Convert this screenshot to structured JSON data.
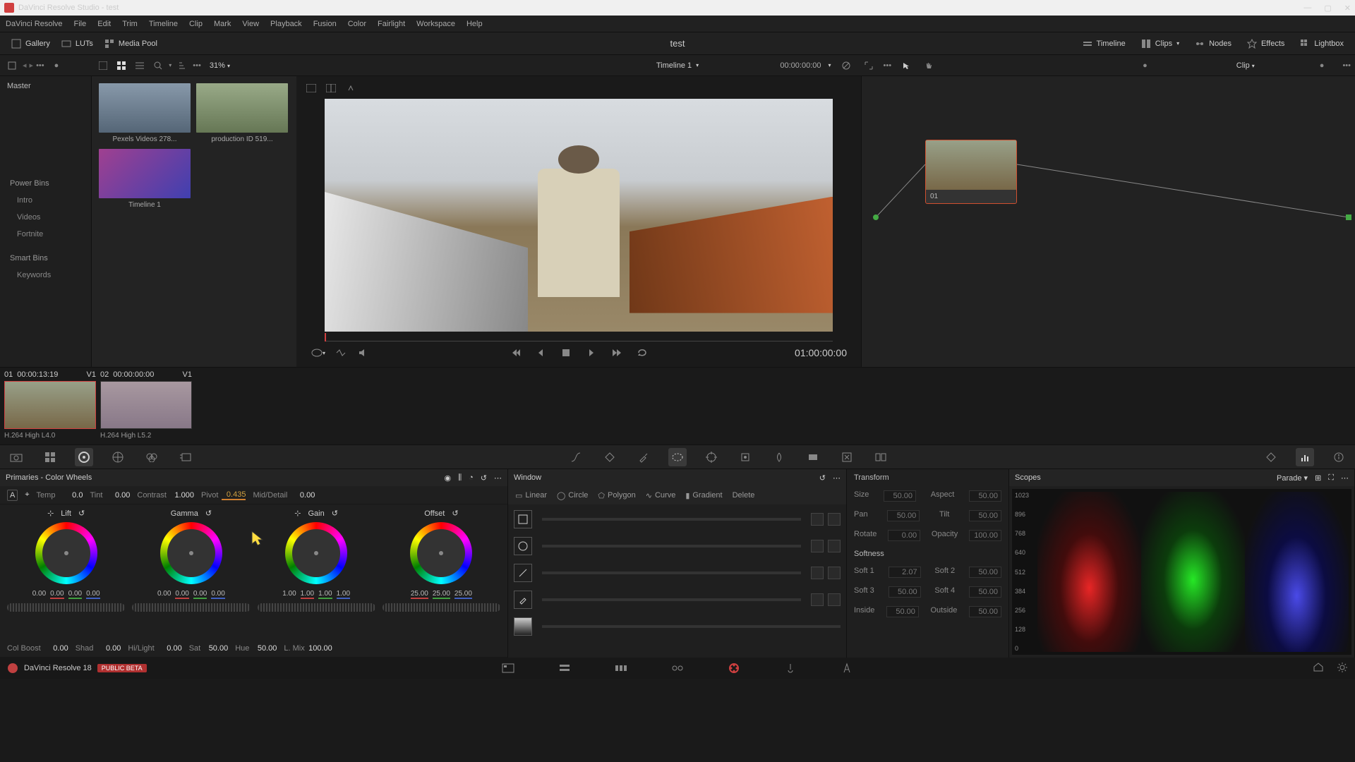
{
  "window": {
    "title": "DaVinci Resolve Studio - test"
  },
  "menu": [
    "DaVinci Resolve",
    "File",
    "Edit",
    "Trim",
    "Timeline",
    "Clip",
    "Mark",
    "View",
    "Playback",
    "Fusion",
    "Color",
    "Fairlight",
    "Workspace",
    "Help"
  ],
  "toolbar": {
    "gallery": "Gallery",
    "luts": "LUTs",
    "mediapool": "Media Pool",
    "project": "test",
    "timeline_btn": "Timeline",
    "clips_btn": "Clips",
    "nodes_btn": "Nodes",
    "effects_btn": "Effects",
    "lightbox_btn": "Lightbox"
  },
  "subbar": {
    "zoom": "31%",
    "timeline_name": "Timeline 1",
    "timecode": "00:00:00:00",
    "clip_label": "Clip"
  },
  "mediapool": {
    "master": "Master",
    "powerbins": "Power Bins",
    "bins": [
      "Intro",
      "Videos",
      "Fortnite"
    ],
    "smartbins": "Smart Bins",
    "smart_items": [
      "Keywords"
    ],
    "thumbs": [
      {
        "label": "Pexels Videos 278..."
      },
      {
        "label": "production ID 519..."
      },
      {
        "label": "Timeline 1",
        "type": "timeline"
      }
    ]
  },
  "viewer": {
    "tc": "01:00:00:00"
  },
  "node": {
    "label": "01"
  },
  "clips": [
    {
      "idx": "01",
      "tc": "00:00:13:19",
      "layer": "V1",
      "codec": "H.264 High L4.0",
      "active": true
    },
    {
      "idx": "02",
      "tc": "00:00:00:00",
      "layer": "V1",
      "codec": "H.264 High L5.2",
      "active": false
    }
  ],
  "primaries": {
    "title": "Primaries - Color Wheels",
    "adjust": {
      "temp_l": "Temp",
      "temp_v": "0.0",
      "tint_l": "Tint",
      "tint_v": "0.00",
      "contrast_l": "Contrast",
      "contrast_v": "1.000",
      "pivot_l": "Pivot",
      "pivot_v": "0.435",
      "md_l": "Mid/Detail",
      "md_v": "0.00"
    },
    "wheels": [
      {
        "name": "Lift",
        "vals": [
          "0.00",
          "0.00",
          "0.00",
          "0.00"
        ]
      },
      {
        "name": "Gamma",
        "vals": [
          "0.00",
          "0.00",
          "0.00",
          "0.00"
        ]
      },
      {
        "name": "Gain",
        "vals": [
          "1.00",
          "1.00",
          "1.00",
          "1.00"
        ]
      },
      {
        "name": "Offset",
        "vals": [
          "25.00",
          "25.00",
          "25.00"
        ]
      }
    ],
    "bottom": {
      "colboost_l": "Col Boost",
      "colboost_v": "0.00",
      "shad_l": "Shad",
      "shad_v": "0.00",
      "hl_l": "Hi/Light",
      "hl_v": "0.00",
      "sat_l": "Sat",
      "sat_v": "50.00",
      "hue_l": "Hue",
      "hue_v": "50.00",
      "lmix_l": "L. Mix",
      "lmix_v": "100.00"
    }
  },
  "window_panel": {
    "title": "Window",
    "tabs": [
      "Linear",
      "Circle",
      "Polygon",
      "Curve",
      "Gradient",
      "Delete"
    ]
  },
  "transform": {
    "head": "Transform",
    "rows": [
      {
        "l": "Size",
        "v": "50.00",
        "l2": "Aspect",
        "v2": "50.00"
      },
      {
        "l": "Pan",
        "v": "50.00",
        "l2": "Tilt",
        "v2": "50.00"
      },
      {
        "l": "Rotate",
        "v": "0.00",
        "l2": "Opacity",
        "v2": "100.00"
      }
    ],
    "soft_head": "Softness",
    "soft": [
      {
        "l": "Soft 1",
        "v": "2.07",
        "l2": "Soft 2",
        "v2": "50.00"
      },
      {
        "l": "Soft 3",
        "v": "50.00",
        "l2": "Soft 4",
        "v2": "50.00"
      },
      {
        "l": "Inside",
        "v": "50.00",
        "l2": "Outside",
        "v2": "50.00"
      }
    ]
  },
  "scopes": {
    "title": "Scopes",
    "mode": "Parade",
    "ticks": [
      "1023",
      "896",
      "768",
      "640",
      "512",
      "384",
      "256",
      "128",
      "0"
    ]
  },
  "footer": {
    "app": "DaVinci Resolve 18",
    "beta": "PUBLIC BETA"
  }
}
